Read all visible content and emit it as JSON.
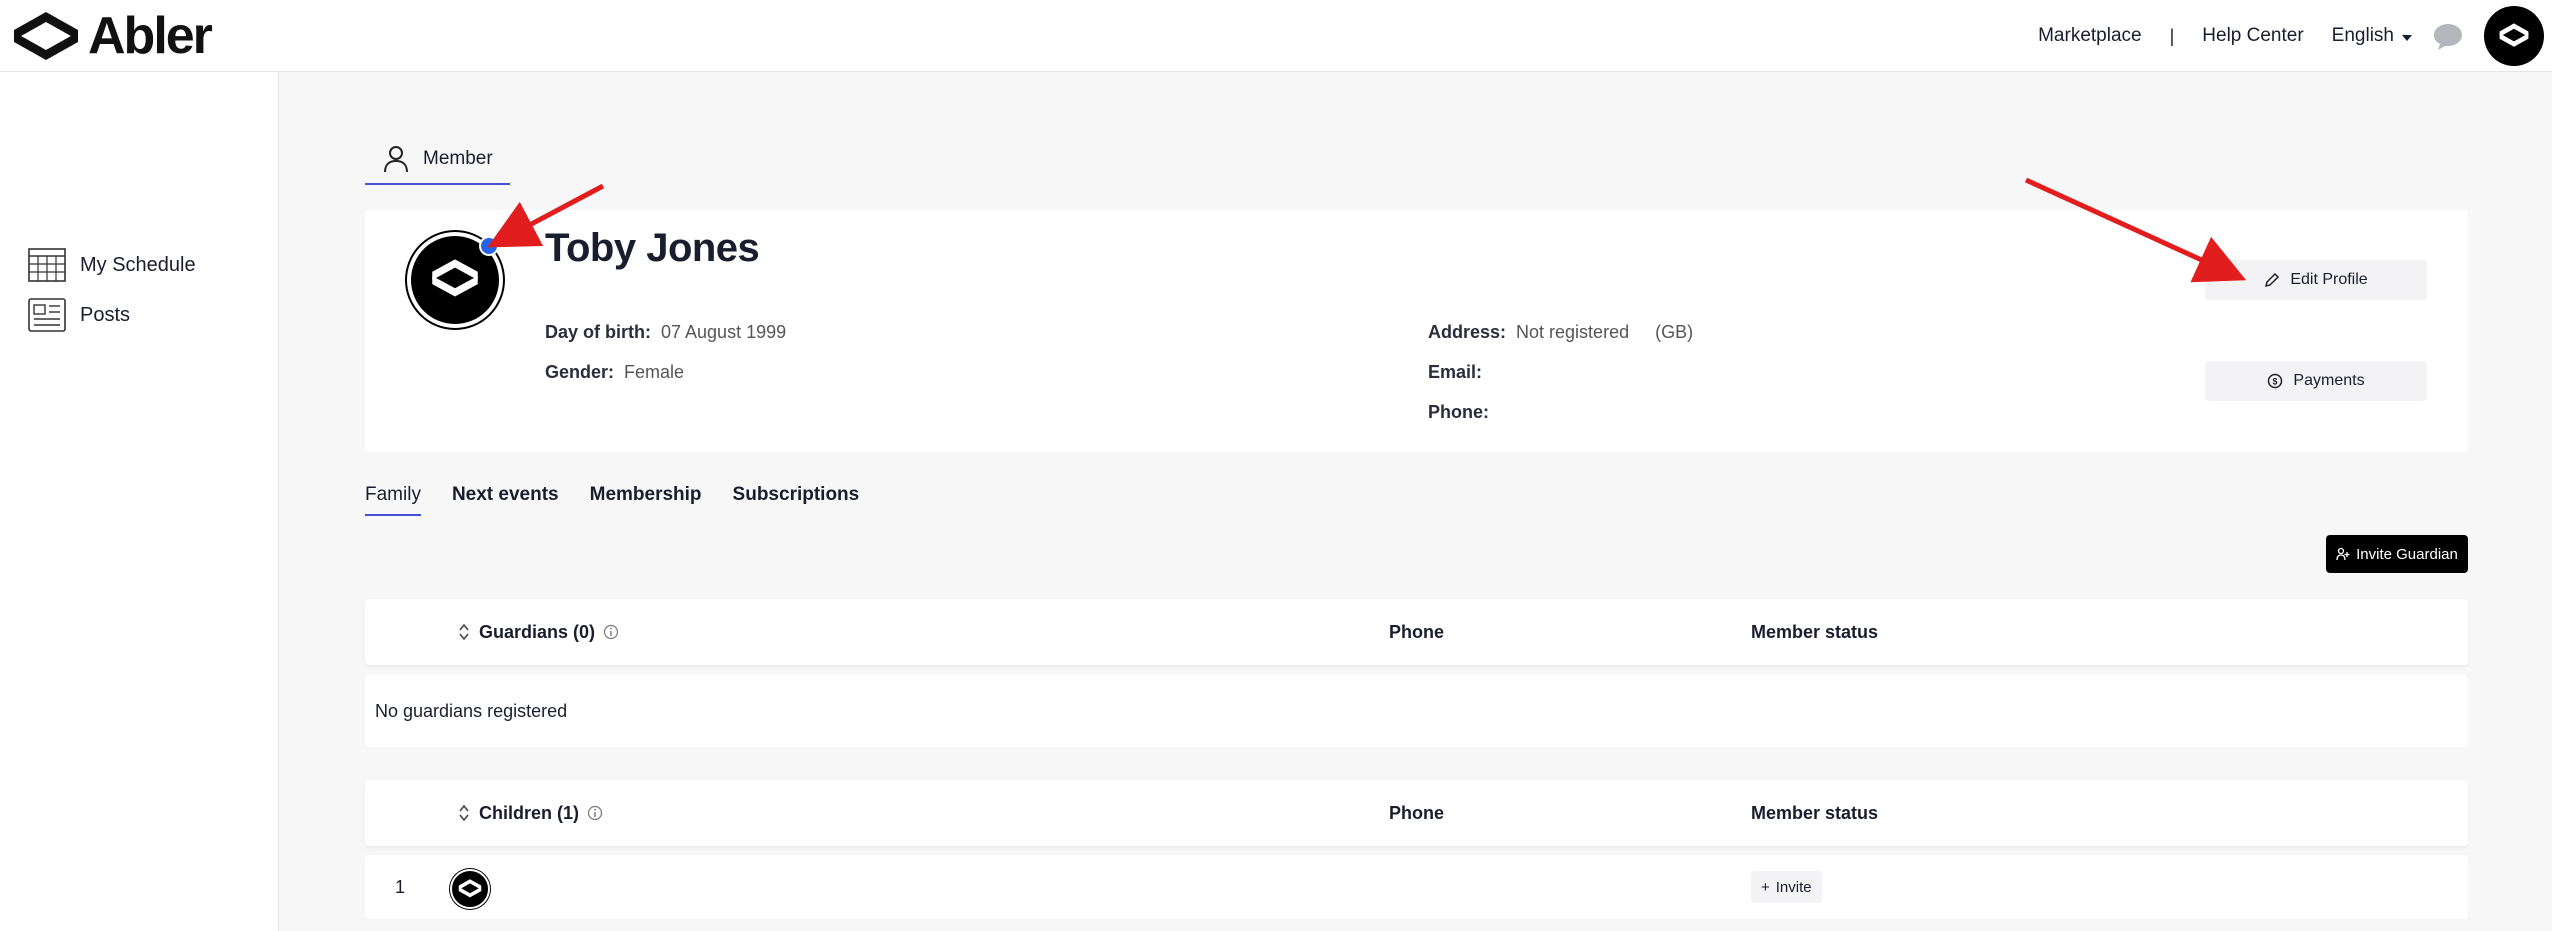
{
  "brand": {
    "name": "Abler"
  },
  "topnav": {
    "marketplace": "Marketplace",
    "separator": "|",
    "help_center": "Help Center",
    "language": "English"
  },
  "sidebar": {
    "items": [
      {
        "label": "My Schedule",
        "icon": "calendar-grid-icon"
      },
      {
        "label": "Posts",
        "icon": "newspaper-icon"
      }
    ]
  },
  "member_tab": {
    "label": "Member",
    "icon": "person-icon"
  },
  "profile": {
    "name": "Toby Jones",
    "dob_label": "Day of birth:",
    "dob_value": "07 August 1999",
    "gender_label": "Gender:",
    "gender_value": "Female",
    "address_label": "Address:",
    "address_value": "Not registered",
    "address_country": "(GB)",
    "email_label": "Email:",
    "email_value": "",
    "phone_label": "Phone:",
    "phone_value": "",
    "edit_profile": "Edit Profile",
    "payments": "Payments"
  },
  "tabs": [
    "Family",
    "Next events",
    "Membership",
    "Subscriptions"
  ],
  "active_tab": "Family",
  "invite_guardian": "Invite Guardian",
  "guardians": {
    "header": "Guardians",
    "count": "(0)",
    "phone_col": "Phone",
    "status_col": "Member status",
    "empty": "No guardians registered"
  },
  "children": {
    "header": "Children",
    "count": "(1)",
    "phone_col": "Phone",
    "status_col": "Member status",
    "rows": [
      {
        "num": "1",
        "phone": "",
        "status_action": "Invite"
      }
    ]
  },
  "colors": {
    "accent": "#4a4fd8",
    "annotation": "#e11d1d",
    "badge": "#2563eb"
  }
}
